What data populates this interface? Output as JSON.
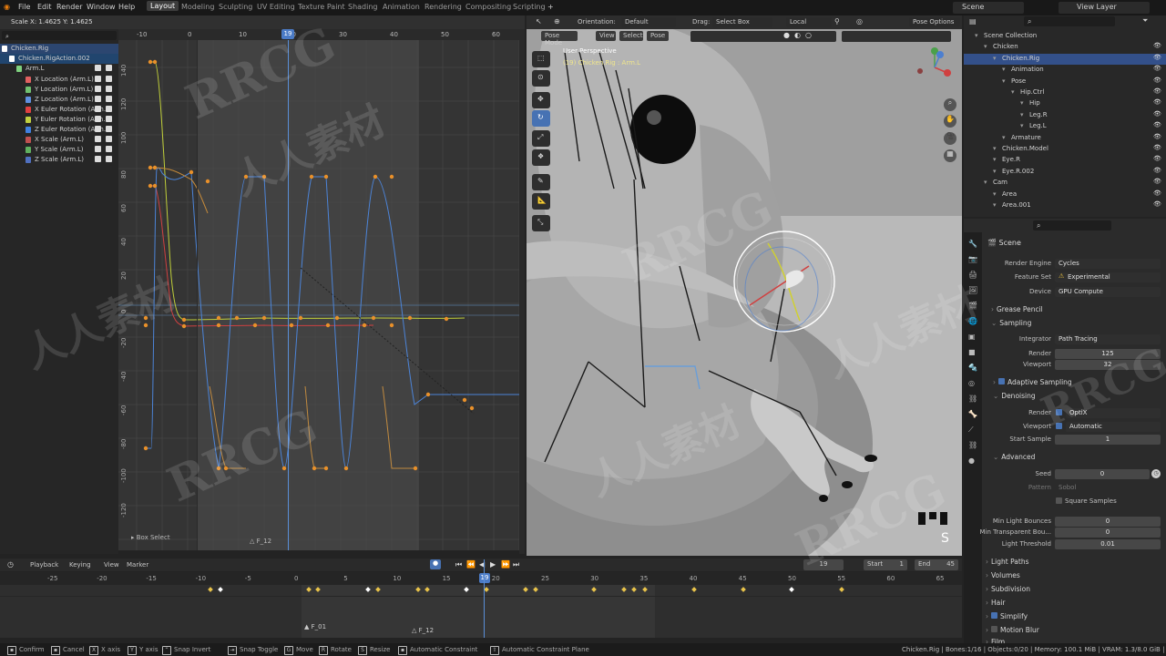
{
  "topbar": {
    "menus": [
      "File",
      "Edit",
      "Render",
      "Window",
      "Help"
    ],
    "workspaces": [
      "Layout",
      "Modeling",
      "Sculpting",
      "UV Editing",
      "Texture Paint",
      "Shading",
      "Animation",
      "Rendering",
      "Compositing",
      "Scripting"
    ],
    "active_workspace": "Layout",
    "add_tab": "+",
    "scene": "Scene",
    "view_layer": "View Layer"
  },
  "graph_editor": {
    "scale_readout": "Scale X: 1.4625   Y: 1.4625",
    "frame_indicator": "19",
    "ruler_labels": [
      "-10",
      "0",
      "10",
      "20",
      "30",
      "40",
      "50",
      "60"
    ],
    "y_labels": [
      "140",
      "120",
      "100",
      "80",
      "60",
      "40",
      "20",
      "0",
      "-20",
      "-40",
      "-60",
      "-80",
      "-100",
      "-120"
    ],
    "channels": [
      {
        "label": "Chicken.Rig",
        "color": "#ffffff"
      },
      {
        "label": "Chicken.RigAction.002",
        "color": "#ffffff"
      },
      {
        "label": "Arm.L",
        "color": "#7fd17f"
      },
      {
        "label": "X Location (Arm.L)",
        "color": "#e06060"
      },
      {
        "label": "Y Location (Arm.L)",
        "color": "#70c070"
      },
      {
        "label": "Z Location (Arm.L)",
        "color": "#6090e0"
      },
      {
        "label": "X Euler Rotation (Arm.L)",
        "color": "#e04040"
      },
      {
        "label": "Y Euler Rotation (Arm.L)",
        "color": "#c0d040"
      },
      {
        "label": "Z Euler Rotation (Arm.L)",
        "color": "#4080e0"
      },
      {
        "label": "X Scale (Arm.L)",
        "color": "#c05050"
      },
      {
        "label": "Y Scale (Arm.L)",
        "color": "#60b060"
      },
      {
        "label": "Z Scale (Arm.L)",
        "color": "#5070c0"
      }
    ],
    "box_select": "Box Select",
    "marker_label": "F_12"
  },
  "viewport": {
    "orientation_label": "Orientation:",
    "orientation_value": "Default",
    "drag_label": "Drag:",
    "drag_value": "Select Box",
    "transform_space": "Local",
    "options": "Pose Options",
    "mode": "Pose Mode",
    "menus": [
      "View",
      "Select",
      "Pose"
    ],
    "view_name": "User Perspective",
    "object_info": "(19) Chicken.Rig : Arm.L",
    "corner_letter": "S"
  },
  "outliner": {
    "search_placeholder": "",
    "rows": [
      {
        "label": "Scene Collection",
        "indent": 0
      },
      {
        "label": "Chicken",
        "indent": 1
      },
      {
        "label": "Chicken.Rig",
        "indent": 2
      },
      {
        "label": "Animation",
        "indent": 3
      },
      {
        "label": "Pose",
        "indent": 3
      },
      {
        "label": "Hip.Ctrl",
        "indent": 4
      },
      {
        "label": "Hip",
        "indent": 5
      },
      {
        "label": "Leg.R",
        "indent": 5
      },
      {
        "label": "Leg.L",
        "indent": 5
      },
      {
        "label": "Armature",
        "indent": 3
      },
      {
        "label": "Chicken.Model",
        "indent": 2
      },
      {
        "label": "Eye.R",
        "indent": 2
      },
      {
        "label": "Eye.R.002",
        "indent": 2
      },
      {
        "label": "Cam",
        "indent": 1
      },
      {
        "label": "Area",
        "indent": 2
      },
      {
        "label": "Area.001",
        "indent": 2
      }
    ]
  },
  "properties": {
    "context": "Scene",
    "render_engine_label": "Render Engine",
    "render_engine": "Cycles",
    "feature_set_label": "Feature Set",
    "feature_set": "Experimental",
    "device_label": "Device",
    "device": "GPU Compute",
    "grease_pencil": "Grease Pencil",
    "sampling": "Sampling",
    "integrator_label": "Integrator",
    "integrator": "Path Tracing",
    "render_label": "Render",
    "render_samples": "125",
    "viewport_label": "Viewport",
    "viewport_samples": "32",
    "adaptive_sampling": "Adaptive Sampling",
    "denoising": "Denoising",
    "denoise_render_label": "Render",
    "denoise_render": "OptiX",
    "denoise_viewport_label": "Viewport",
    "denoise_viewport": "Automatic",
    "start_sample_label": "Start Sample",
    "start_sample": "1",
    "advanced": "Advanced",
    "seed_label": "Seed",
    "seed": "0",
    "pattern_label": "Pattern",
    "pattern": "Sobol",
    "square_samples": "Square Samples",
    "min_light_bounces_label": "Min Light Bounces",
    "min_light_bounces": "0",
    "min_transparent_label": "Min Transparent Bou...",
    "min_transparent": "0",
    "light_threshold_label": "Light Threshold",
    "light_threshold": "0.01",
    "light_paths": "Light Paths",
    "volumes": "Volumes",
    "subdivision": "Subdivision",
    "hair": "Hair",
    "simplify": "Simplify",
    "motion_blur": "Motion Blur",
    "film": "Film"
  },
  "timeline": {
    "menus": [
      "Playback",
      "Keying",
      "View",
      "Marker"
    ],
    "current_frame": "19",
    "start_label": "Start",
    "start": "1",
    "end_label": "End",
    "end": "45",
    "ruler_labels": [
      "-25",
      "-20",
      "-15",
      "-10",
      "-5",
      "0",
      "5",
      "10",
      "15",
      "20",
      "25",
      "30",
      "35",
      "40",
      "45",
      "50",
      "55",
      "60",
      "65"
    ],
    "frame_badge": "19",
    "markers": [
      "F_01",
      "F_12"
    ]
  },
  "statusbar": {
    "items": [
      "Confirm",
      "Cancel",
      "X axis",
      "Y axis",
      "Snap Invert",
      "Snap Toggle",
      "Move",
      "Rotate",
      "Resize",
      "Automatic Constraint",
      "Automatic Constraint Plane"
    ],
    "info": "Chicken.Rig | Bones:1/16 | Objects:0/20 | Memory: 100.1 MiB | VRAM: 1.3/8.0 GiB | 2.91.0"
  },
  "watermarks": [
    "RRCG",
    "人人素材"
  ]
}
